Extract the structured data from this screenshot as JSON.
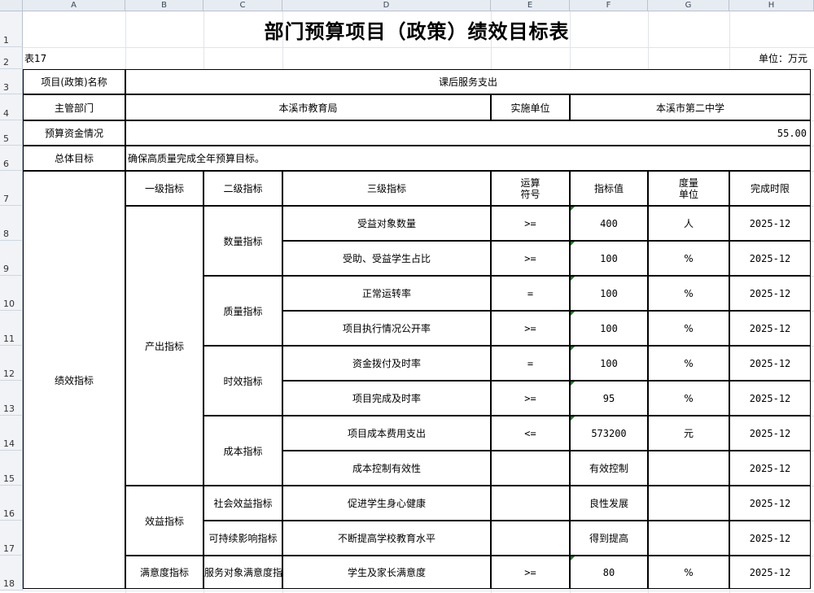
{
  "columns": [
    "A",
    "B",
    "C",
    "D",
    "E",
    "F",
    "G",
    "H"
  ],
  "rows": [
    "1",
    "2",
    "3",
    "4",
    "5",
    "6",
    "7",
    "8",
    "9",
    "10",
    "11",
    "12",
    "13",
    "14",
    "15",
    "16",
    "17",
    "18"
  ],
  "title": "部门预算项目（政策）绩效目标表",
  "table_no": "表17",
  "unit": "单位：万元",
  "project_name_label": "项目(政策)名称",
  "project_name": "课后服务支出",
  "dept_label": "主管部门",
  "dept": "本溪市教育局",
  "impl_label": "实施单位",
  "impl": "本溪市第二中学",
  "budget_label": "预算资金情况",
  "budget": "55.00",
  "goal_label": "总体目标",
  "goal": "确保高质量完成全年预算目标。",
  "perf_label": "绩效指标",
  "headers": {
    "l1": "一级指标",
    "l2": "二级指标",
    "l3": "三级指标",
    "op": "运算\n符号",
    "val": "指标值",
    "unit": "度量\n单位",
    "deadline": "完成时限"
  },
  "level1": [
    "产出指标",
    "效益指标",
    "满意度指标"
  ],
  "level2": [
    "数量指标",
    "质量指标",
    "时效指标",
    "成本指标",
    "社会效益指标",
    "可持续影响指标",
    "服务对象满意度指标"
  ],
  "indicators": [
    {
      "l3": "受益对象数量",
      "op": ">=",
      "val": "400",
      "unit": "人",
      "deadline": "2025-12"
    },
    {
      "l3": "受助、受益学生占比",
      "op": ">=",
      "val": "100",
      "unit": "%",
      "deadline": "2025-12"
    },
    {
      "l3": "正常运转率",
      "op": "=",
      "val": "100",
      "unit": "%",
      "deadline": "2025-12"
    },
    {
      "l3": "项目执行情况公开率",
      "op": ">=",
      "val": "100",
      "unit": "%",
      "deadline": "2025-12"
    },
    {
      "l3": "资金拨付及时率",
      "op": "=",
      "val": "100",
      "unit": "%",
      "deadline": "2025-12"
    },
    {
      "l3": "项目完成及时率",
      "op": ">=",
      "val": "95",
      "unit": "%",
      "deadline": "2025-12"
    },
    {
      "l3": "项目成本费用支出",
      "op": "<=",
      "val": "573200",
      "unit": "元",
      "deadline": "2025-12"
    },
    {
      "l3": "成本控制有效性",
      "op": "",
      "val": "有效控制",
      "unit": "",
      "deadline": "2025-12"
    },
    {
      "l3": "促进学生身心健康",
      "op": "",
      "val": "良性发展",
      "unit": "",
      "deadline": "2025-12"
    },
    {
      "l3": "不断提高学校教育水平",
      "op": "",
      "val": "得到提高",
      "unit": "",
      "deadline": "2025-12"
    },
    {
      "l3": "学生及家长满意度",
      "op": ">=",
      "val": "80",
      "unit": "%",
      "deadline": "2025-12"
    }
  ],
  "colors": {
    "border": "#000000",
    "header_bg": "#e7ecf3",
    "comment_marker": "#1f7a1f"
  }
}
